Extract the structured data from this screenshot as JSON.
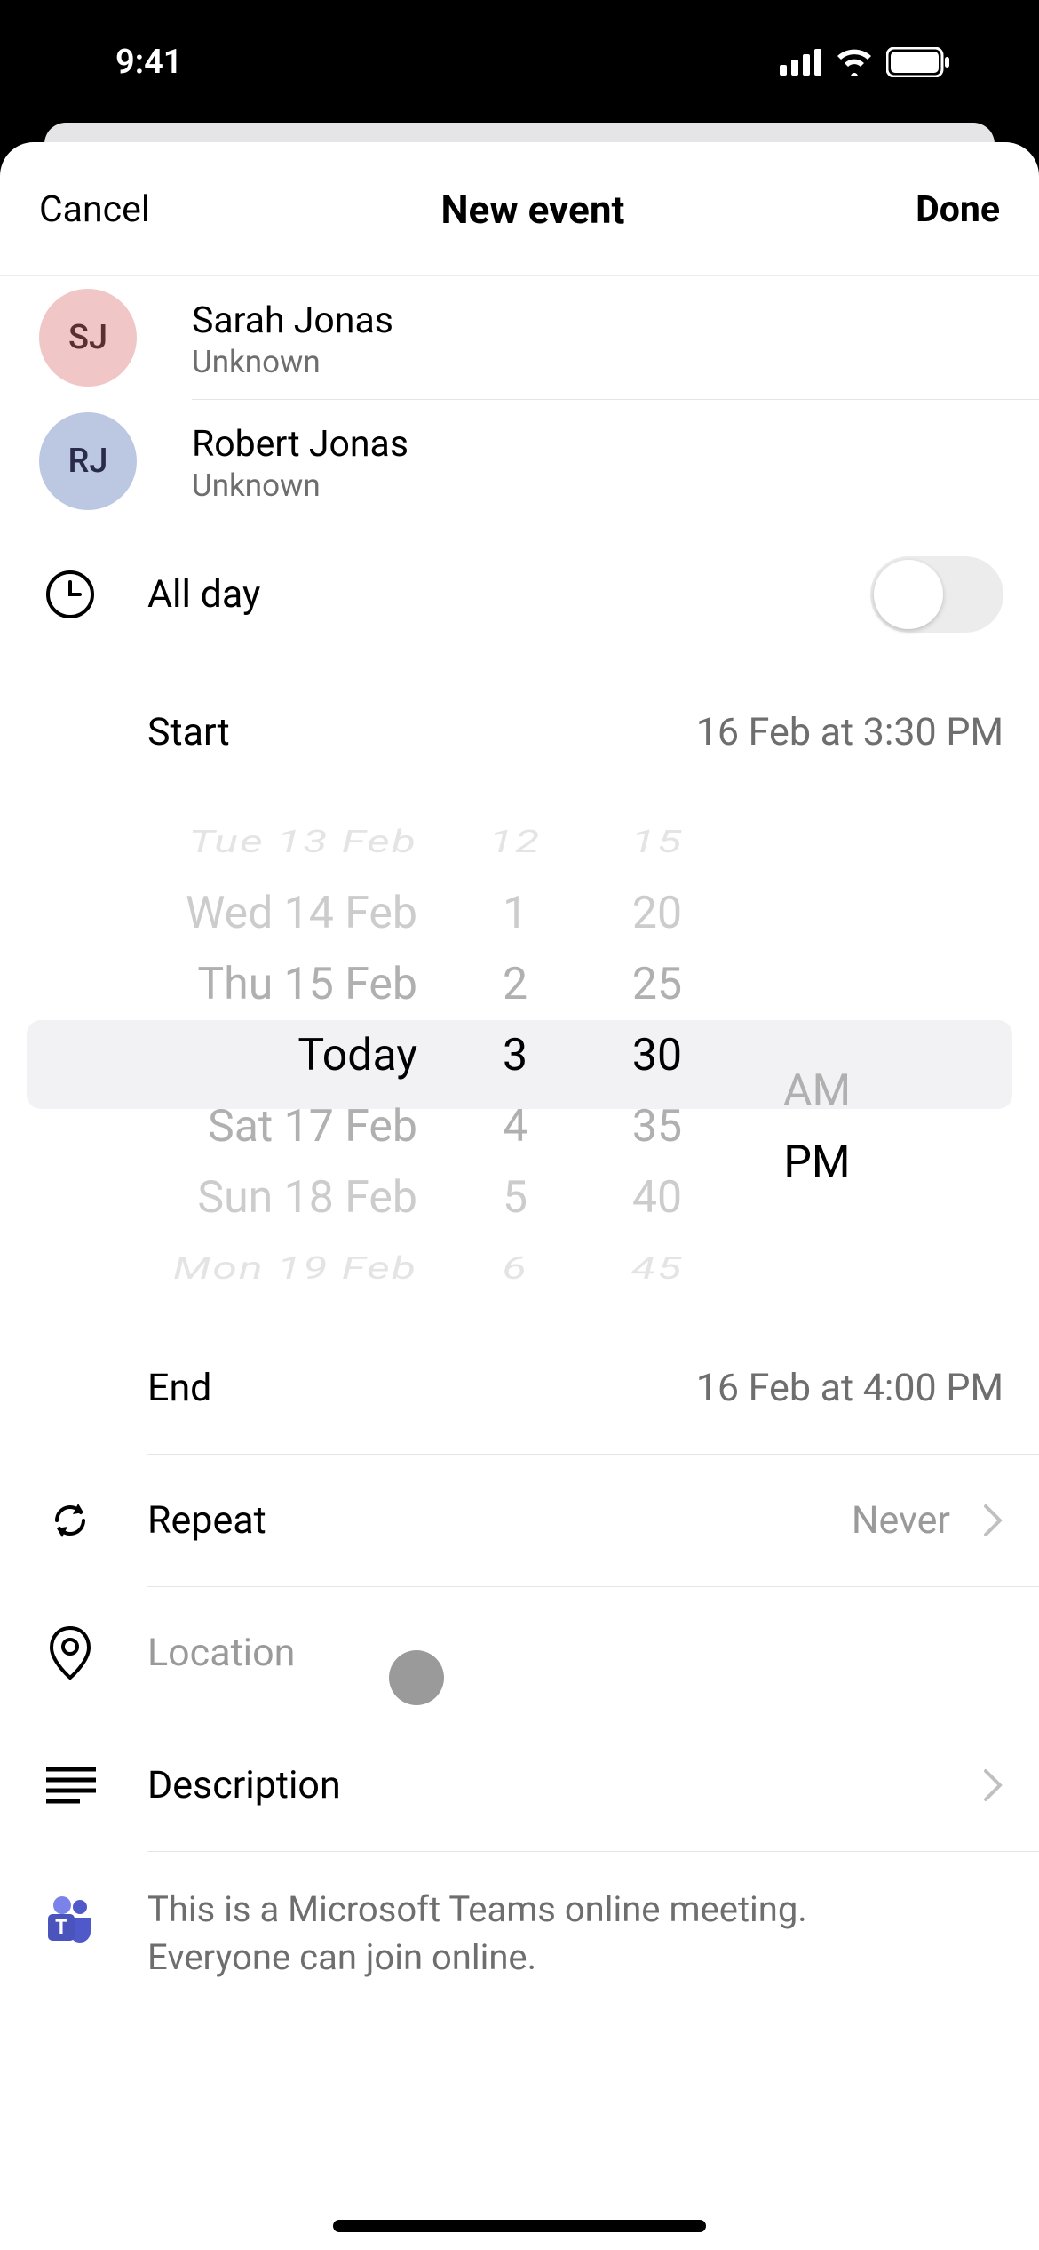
{
  "status": {
    "time": "9:41"
  },
  "modal": {
    "cancel": "Cancel",
    "title": "New event",
    "done": "Done"
  },
  "attendees": [
    {
      "initials": "SJ",
      "name": "Sarah Jonas",
      "sub": "Unknown",
      "color": "pink"
    },
    {
      "initials": "RJ",
      "name": "Robert Jonas",
      "sub": "Unknown",
      "color": "blue"
    }
  ],
  "allday": {
    "label": "All day",
    "on": false
  },
  "start": {
    "label": "Start",
    "value": "16 Feb at 3:30 PM"
  },
  "end": {
    "label": "End",
    "value": "16 Feb at 4:00 PM"
  },
  "picker": {
    "dates": [
      "Tue 13 Feb",
      "Wed 14 Feb",
      "Thu 15 Feb",
      "Today",
      "Sat 17 Feb",
      "Sun 18 Feb",
      "Mon 19 Feb"
    ],
    "hours": [
      "12",
      "1",
      "2",
      "3",
      "4",
      "5",
      "6"
    ],
    "minutes": [
      "15",
      "20",
      "25",
      "30",
      "35",
      "40",
      "45"
    ],
    "ampm": [
      "AM",
      "PM"
    ]
  },
  "repeat": {
    "label": "Repeat",
    "value": "Never"
  },
  "location": {
    "placeholder": "Location"
  },
  "description": {
    "label": "Description"
  },
  "teams": {
    "line1": "This is a Microsoft Teams online meeting.",
    "line2": "Everyone can join online."
  }
}
